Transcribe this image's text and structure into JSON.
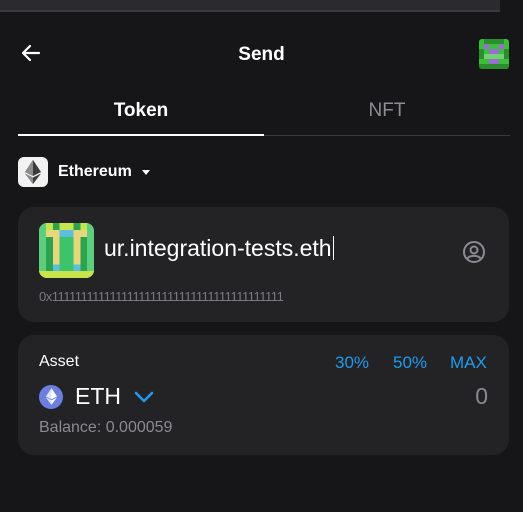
{
  "header": {
    "title": "Send",
    "back_icon": "arrow-left-icon"
  },
  "tabs": [
    {
      "label": "Token",
      "active": true
    },
    {
      "label": "NFT",
      "active": false
    }
  ],
  "network": {
    "label": "Ethereum",
    "icon": "ethereum-icon"
  },
  "recipient": {
    "name": "ur.integration-tests.eth",
    "address": "0x1111111111111111111111111111111111111111"
  },
  "asset": {
    "label": "Asset",
    "quick_amounts": [
      "30%",
      "50%",
      "MAX"
    ],
    "token": "ETH",
    "amount": "0",
    "balance": "Balance: 0.000059"
  },
  "colors": {
    "accent": "#1e9bf0",
    "background": "#161618",
    "card": "#232326"
  }
}
